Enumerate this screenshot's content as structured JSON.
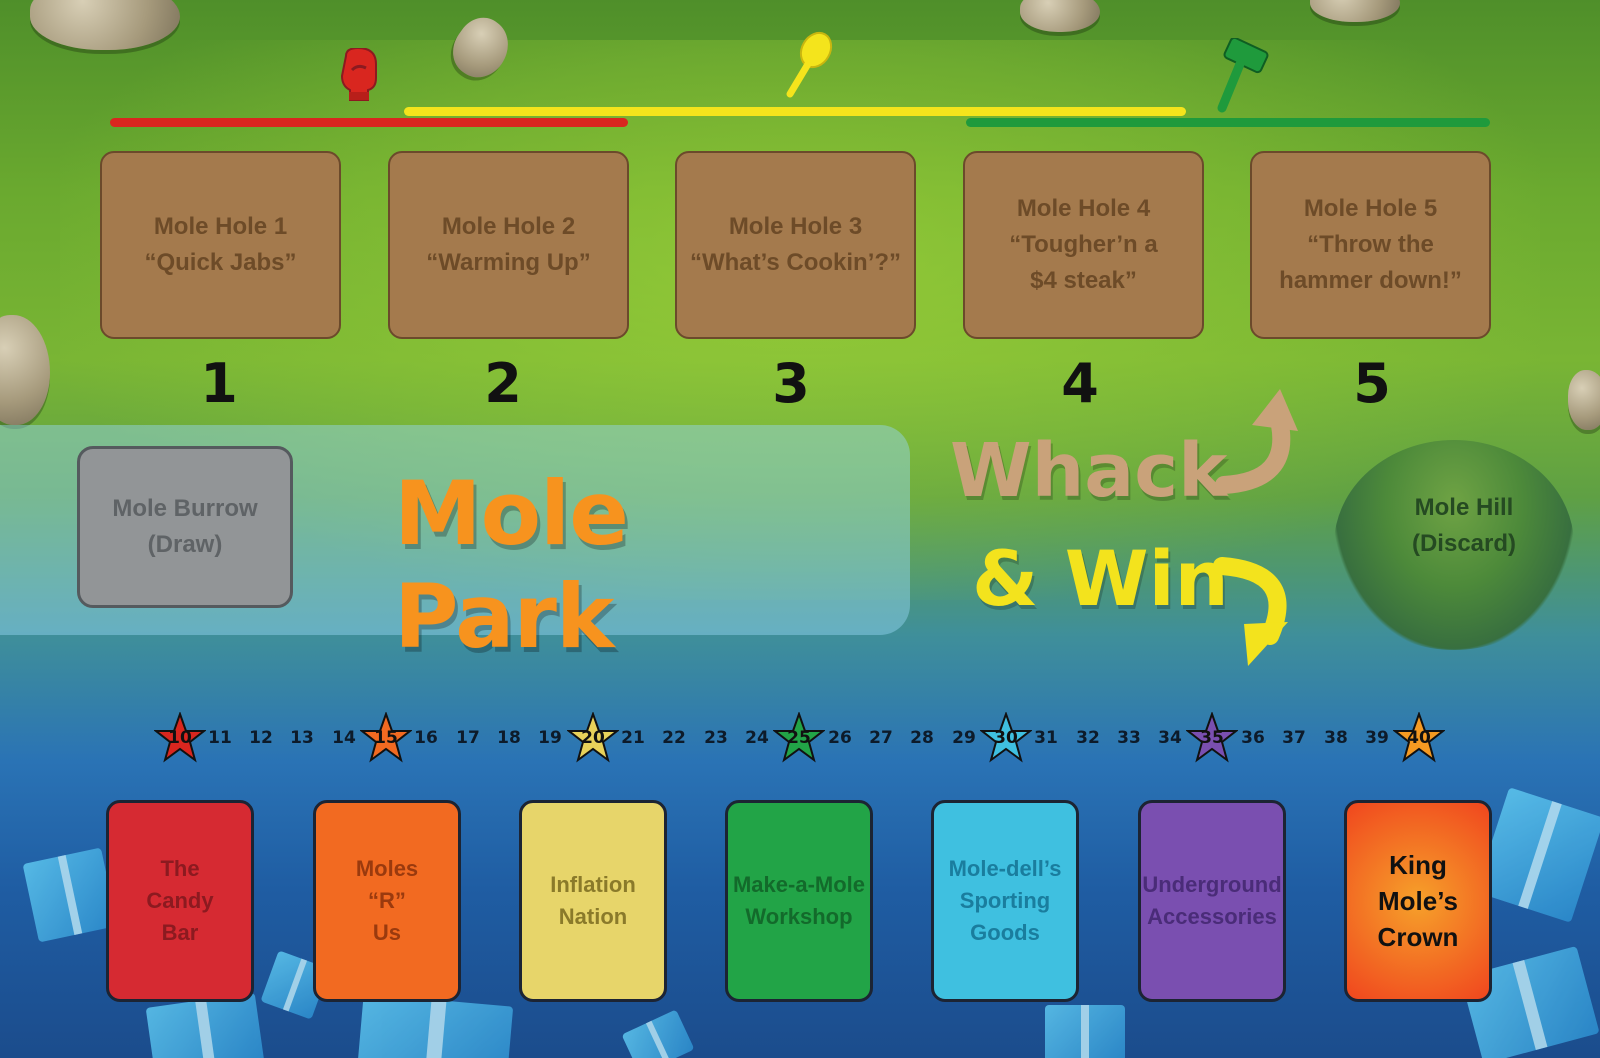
{
  "colors": {
    "track_red": "#d9261f",
    "track_yellow": "#f4e41c",
    "track_green": "#1f9a3c",
    "mole_hole_card": "#a47a4d",
    "mole_park_title": "#f7931e",
    "whack_text": "#c9a27a",
    "win_text": "#f3e31d"
  },
  "track_icons": [
    "boxing-glove-icon",
    "spoon-icon",
    "hammer-icon"
  ],
  "mole_holes": [
    {
      "label": "Mole Hole 1\n“Quick Jabs”",
      "number": "1"
    },
    {
      "label": "Mole Hole 2\n“Warming Up”",
      "number": "2"
    },
    {
      "label": "Mole Hole 3\n“What’s Cookin’?”",
      "number": "3"
    },
    {
      "label": "Mole Hole 4\n“Tougher’n a\n$4 steak”",
      "number": "4"
    },
    {
      "label": "Mole Hole 5\n“Throw the\nhammer down!”",
      "number": "5"
    }
  ],
  "burrow": {
    "label": "Mole Burrow\n(Draw)"
  },
  "title": "Mole Park",
  "logo": {
    "line1": "Whack",
    "line2": "& Win"
  },
  "mole_hill": {
    "label": "Mole Hill\n(Discard)"
  },
  "score_track": {
    "numbers": [
      "10",
      "11",
      "12",
      "13",
      "14",
      "15",
      "16",
      "17",
      "18",
      "19",
      "20",
      "21",
      "22",
      "23",
      "24",
      "25",
      "26",
      "27",
      "28",
      "29",
      "30",
      "31",
      "32",
      "33",
      "34",
      "35",
      "36",
      "37",
      "38",
      "39",
      "40"
    ],
    "stars": [
      {
        "value": "10",
        "color": "#d9261f"
      },
      {
        "value": "15",
        "color": "#f26a21"
      },
      {
        "value": "20",
        "color": "#e8d25a"
      },
      {
        "value": "25",
        "color": "#22a447"
      },
      {
        "value": "30",
        "color": "#3fc0e0"
      },
      {
        "value": "35",
        "color": "#7a4fb0"
      },
      {
        "value": "40",
        "color": "#f59a22"
      }
    ]
  },
  "stores": [
    {
      "label": "The\nCandy\nBar",
      "bg": "#d62a32",
      "text_color": "#8c1a20"
    },
    {
      "label": "Moles\n“R”\nUs",
      "bg": "#f26a21",
      "text_color": "#9a3a0e"
    },
    {
      "label": "Inflation\nNation",
      "bg": "#e7d56a",
      "text_color": "#8a7a2a"
    },
    {
      "label": "Make-a-Mole\nWorkshop",
      "bg": "#22a447",
      "text_color": "#136a2b"
    },
    {
      "label": "Mole-dell’s\nSporting\nGoods",
      "bg": "#3fc0e0",
      "text_color": "#1a7d9e"
    },
    {
      "label": "Underground\nAccessories",
      "bg": "#7a4fb0",
      "text_color": "#4a2c78"
    },
    {
      "label": "King\nMole’s\nCrown",
      "bg": "#f26a21",
      "text_color": "#111111"
    }
  ]
}
